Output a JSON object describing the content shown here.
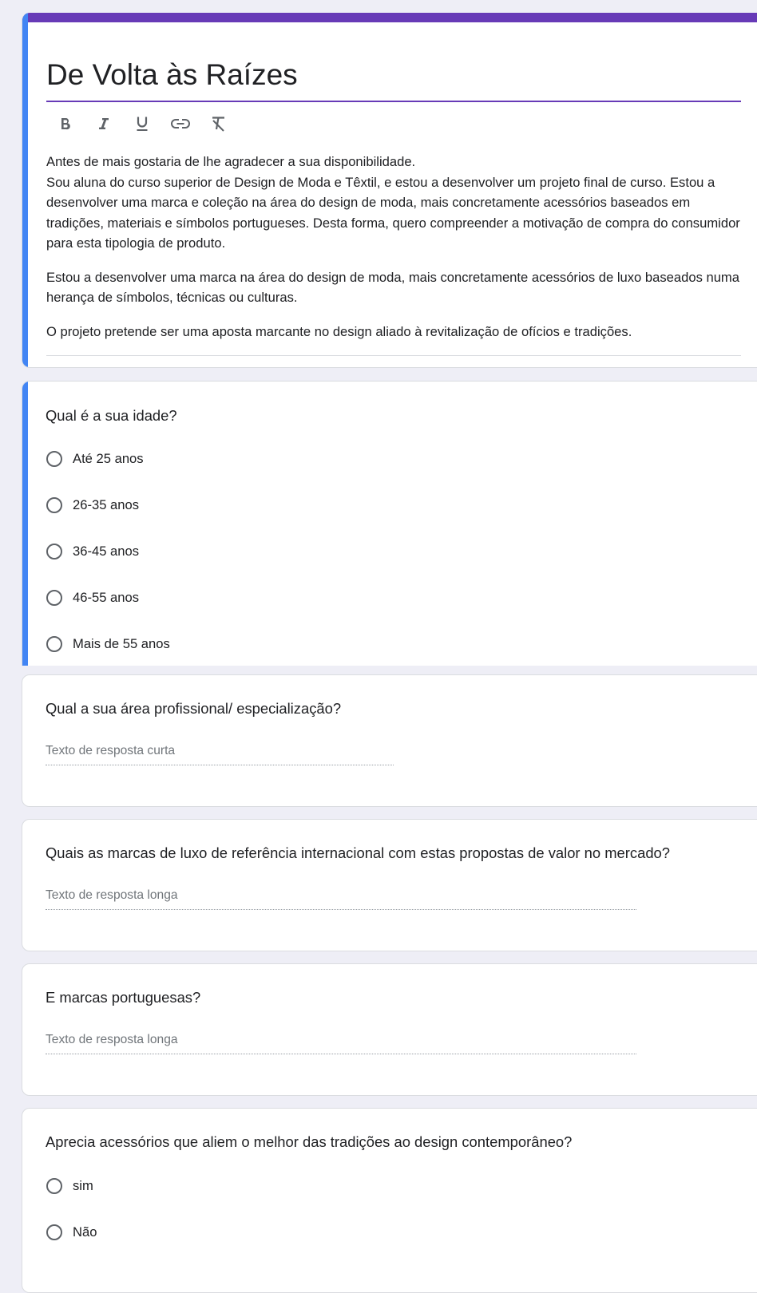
{
  "form": {
    "title": "De Volta às Raízes",
    "toolbar": [
      "bold",
      "italic",
      "underline",
      "link",
      "clear-formatting"
    ],
    "description": [
      "Antes de mais gostaria de lhe agradecer a sua disponibilidade.\nSou aluna do curso superior de Design de Moda e Têxtil, e estou a desenvolver um projeto final de curso. Estou a desenvolver uma marca e coleção na área do design de moda, mais concretamente acessórios baseados em tradições, materiais e símbolos portugueses. Desta forma, quero compreender a motivação de compra do consumidor para esta tipologia de produto.",
      "Estou a desenvolver uma marca na área do design de moda, mais concretamente acessórios de luxo baseados numa herança de símbolos, técnicas ou culturas.",
      "O projeto pretende ser uma aposta marcante no design aliado à revitalização de ofícios e tradições."
    ]
  },
  "colors": {
    "theme": "#673ab7",
    "active_accent": "#4285f4",
    "background": "#eeeef6"
  },
  "questions": [
    {
      "title": "Qual é a sua idade?",
      "type": "radio",
      "options": [
        "Até 25 anos",
        "26-35 anos",
        "36-45 anos",
        "46-55 anos",
        "Mais de 55 anos"
      ]
    },
    {
      "title": "Qual a sua área profissional/ especialização?",
      "type": "short",
      "placeholder": "Texto de resposta curta"
    },
    {
      "title": "Quais as marcas de luxo de referência internacional com estas propostas de valor no mercado?",
      "type": "long",
      "placeholder": "Texto de resposta longa"
    },
    {
      "title": "E marcas portuguesas?",
      "type": "long",
      "placeholder": "Texto de resposta longa"
    },
    {
      "title": "Aprecia acessórios que aliem o melhor das tradições ao design contemporâneo?",
      "type": "radio",
      "options": [
        "sim",
        "Não"
      ]
    }
  ]
}
